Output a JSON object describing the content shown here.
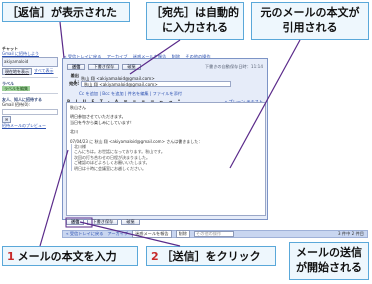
{
  "callouts": {
    "reply_shown": "［返信］が表示された",
    "to_auto": "［宛先］は自動的に入力される",
    "quoted": "元のメールの本文が引用される",
    "step1_num": "1",
    "step1_text": "メールの本文を入力",
    "step2_num": "2",
    "step2_text": "［送信］をクリック",
    "sending_started": "メールの送信が開始される"
  },
  "sidebar": {
    "chat_header": "チャット",
    "gmail_intro": "Gmail に招待しよう",
    "user": "akiyamaloid",
    "status_link": "現在地を表示",
    "all_link": "すべて表示",
    "label_header": "ラベル",
    "label_edit": "ラベルを編集",
    "invite_header": "友人、知人に招待する",
    "invite_count": "Gmail 招待(0):",
    "invite_preview": "招待メールのプレビュー"
  },
  "main": {
    "toplinks": [
      "« 受信トレイに戻る",
      "アーカイブ",
      "迷惑メールを報告",
      "削除",
      "その他の操作"
    ],
    "toolbar_top": [
      "送信",
      "下書き保存",
      "破棄"
    ],
    "save_time": "下書きの自動保存日時：11:14",
    "from_label": "差出人:",
    "to_label": "宛先:",
    "to_value": "秋山 翔 <akiyamaloid@gmail.com>",
    "sublinks": "Cc を追加 | Bcc を追加 | 件名を編集 | ファイルを添付",
    "format_buttons": "B I U F T ꞏ A ⊞ ≣ ≡ ☰ ⇤ ⇥ “",
    "plain_text": "« プレーン テキスト",
    "body": {
      "line1": "秋山さん",
      "line2": "明日参加させていただきます。",
      "line3": "当日を今から楽しみにしています！",
      "line4": "北川",
      "quote_header": "07/04/23 に 秋山 翔 <akiyamaloid@gmail.com> さんは書きました：",
      "quote_line1": "北川様",
      "quote_line2": "こんにちは。お世話になっております。秋山です。",
      "quote_line3": "次回の打ち合わせの日程が決まりました。",
      "quote_line4": "ご確認のほどよろしくお願いいたします。",
      "quote_line5": "明日は十時に会議室にお越しください。"
    },
    "toolbar_bottom": [
      "送信",
      "下書き保存",
      "破棄"
    ],
    "bottom_bar": {
      "back": "« 受信トレイに戻る",
      "archive": "アーカイブ",
      "spam": "迷惑メールを報告",
      "delete": "削除",
      "more": "その他の操作",
      "count": "3 件中 2 件目",
      "search_placeholder": "検索"
    }
  },
  "colors": {
    "callout_border": "#5aa8d9",
    "callout_bg": "#eef7fd",
    "step_number": "#c72a2a",
    "annotation_line": "#5a2a8a"
  }
}
